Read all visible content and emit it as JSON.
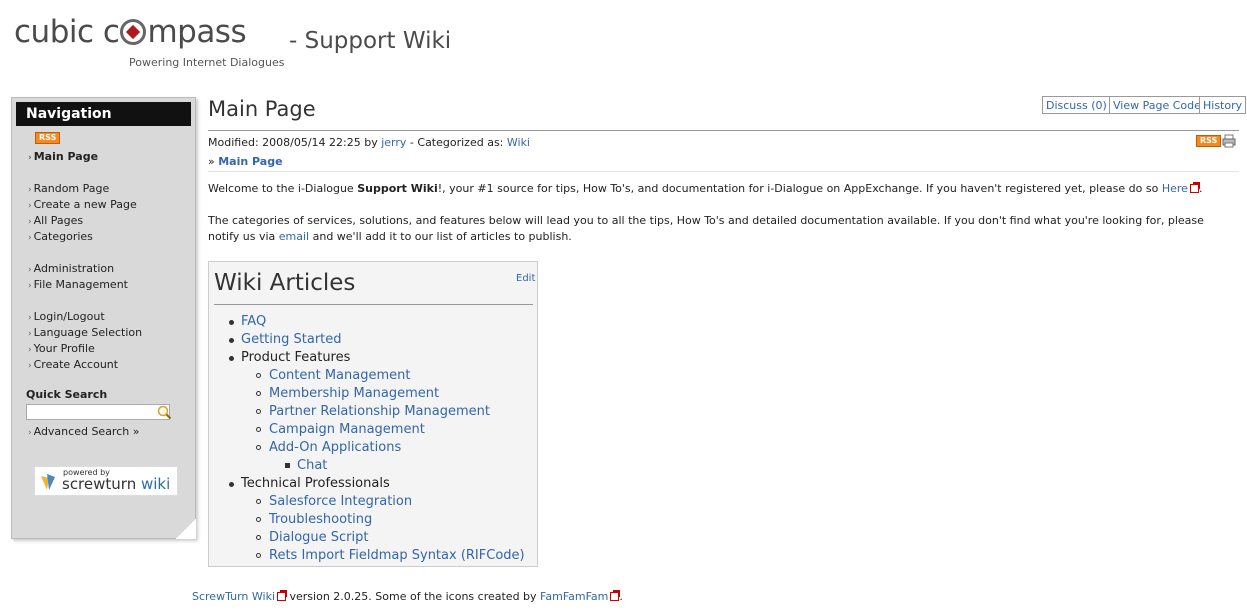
{
  "header": {
    "logo_text_left": "cubic c",
    "logo_text_right": "mpass",
    "site_title": "- Support Wiki",
    "tagline": "Powering Internet Dialogues"
  },
  "sidebar": {
    "title": "Navigation",
    "rss_label": "RSS",
    "current": "Main Page",
    "groups": [
      [
        "Random Page",
        "Create a new Page",
        "All Pages",
        "Categories"
      ],
      [
        "Administration",
        "File Management"
      ],
      [
        "Login/Logout",
        "Language Selection",
        "Your Profile",
        "Create Account"
      ]
    ],
    "quick_search_label": "Quick Search",
    "quick_search_value": "",
    "advanced_search": "Advanced Search »",
    "powered_small": "powered by",
    "powered_brand_a": "screwturn",
    "powered_brand_b": " wiki"
  },
  "page": {
    "title": "Main Page",
    "buttons": {
      "discuss": "Discuss (0)",
      "view_code": "View Page Code",
      "history": "History"
    },
    "meta": {
      "modified_prefix": "Modified: 2008/05/14 22:25 by ",
      "author": "jerry",
      "categorized_prefix": " - Categorized as: ",
      "category": "Wiki",
      "rss": "RSS"
    },
    "breadcrumb_prefix": "» ",
    "breadcrumb": "Main Page",
    "para1": {
      "a": "Welcome to the i-Dialogue ",
      "b": "Support Wiki",
      "c": "!, your #1 source for tips, How To's, and documentation for i-Dialogue on AppExchange. If you haven't registered yet, please do so ",
      "link": "Here",
      "d": "."
    },
    "para2": {
      "a": "The categories of services, solutions, and features below will lead you to all the tips, How To's and detailed documentation available. If you don't find what you're looking for, please notify us via ",
      "link": "email",
      "b": " and we'll add it to our list of articles to publish."
    }
  },
  "articles": {
    "title": "Wiki Articles",
    "edit": "Edit",
    "items": {
      "faq": "FAQ",
      "getting_started": "Getting Started",
      "product_features": "Product Features",
      "content_management": "Content Management",
      "membership_management": "Membership Management",
      "prm": "Partner Relationship Management",
      "campaign_management": "Campaign Management",
      "addon_apps": "Add-On Applications",
      "chat": "Chat",
      "tech_pros": "Technical Professionals",
      "salesforce": "Salesforce Integration",
      "troubleshooting": "Troubleshooting",
      "dialogue_script": "Dialogue Script",
      "rets": "Rets Import Fieldmap Syntax (RIFCode)"
    }
  },
  "footer": {
    "link1": "ScrewTurn Wiki",
    "mid": " version 2.0.25. Some of the icons created by ",
    "link2": "FamFamFam",
    "end": "."
  }
}
